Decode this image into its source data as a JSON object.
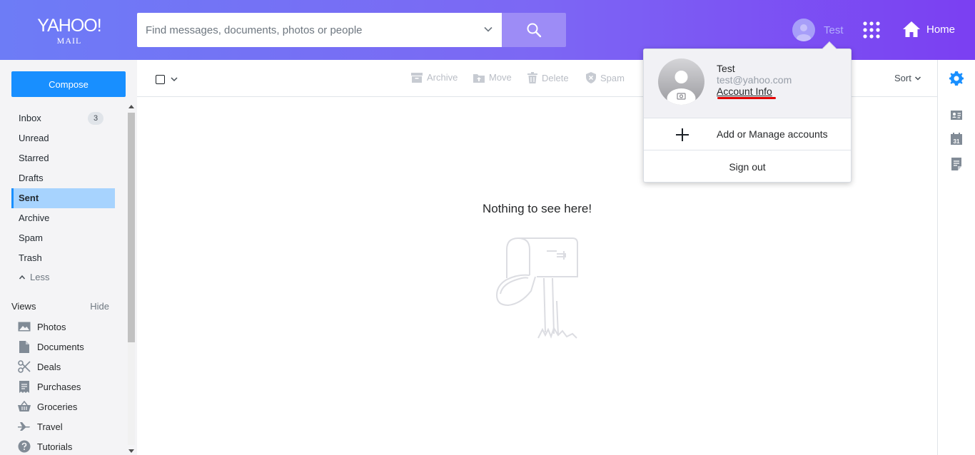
{
  "brand": {
    "line1": "YAHOO!",
    "line2": "MAIL"
  },
  "search": {
    "placeholder": "Find messages, documents, photos or people",
    "value": ""
  },
  "header": {
    "user_name": "Test",
    "home_label": "Home"
  },
  "compose_label": "Compose",
  "folders": [
    {
      "label": "Inbox",
      "count": "3"
    },
    {
      "label": "Unread"
    },
    {
      "label": "Starred"
    },
    {
      "label": "Drafts"
    },
    {
      "label": "Sent",
      "active": true
    },
    {
      "label": "Archive"
    },
    {
      "label": "Spam"
    },
    {
      "label": "Trash"
    }
  ],
  "less_label": "Less",
  "views": {
    "title": "Views",
    "hide_label": "Hide",
    "items": [
      {
        "label": "Photos",
        "icon": "photo-icon"
      },
      {
        "label": "Documents",
        "icon": "document-icon"
      },
      {
        "label": "Deals",
        "icon": "scissors-icon"
      },
      {
        "label": "Purchases",
        "icon": "receipt-icon"
      },
      {
        "label": "Groceries",
        "icon": "basket-icon"
      },
      {
        "label": "Travel",
        "icon": "plane-icon"
      },
      {
        "label": "Tutorials",
        "icon": "help-icon"
      }
    ]
  },
  "toolbar": {
    "archive": "Archive",
    "move": "Move",
    "delete": "Delete",
    "spam": "Spam",
    "sort": "Sort"
  },
  "empty_state": "Nothing to see here!",
  "account_popup": {
    "name": "Test",
    "email": "test@yahoo.com",
    "account_info": "Account Info",
    "manage": "Add or Manage accounts",
    "sign_out": "Sign out"
  },
  "colors": {
    "accent": "#188fff",
    "header_start": "#6d7cf6",
    "header_end": "#7b3ff2",
    "annotation": "#e00000"
  }
}
